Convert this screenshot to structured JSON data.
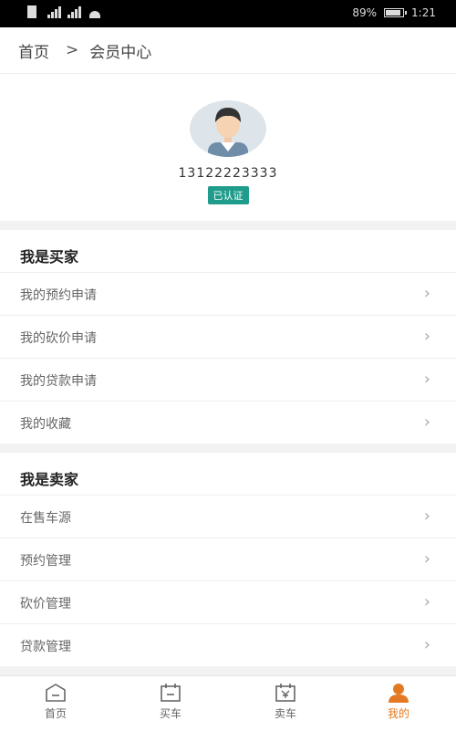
{
  "status": {
    "battery": "89%",
    "time": "1:21"
  },
  "nav": {
    "home": "首页",
    "separator": ">",
    "title": "会员中心"
  },
  "profile": {
    "phone": "13122223333",
    "badge": "已认证"
  },
  "buyer": {
    "title": "我是买家",
    "items": [
      {
        "label": "我的预约申请"
      },
      {
        "label": "我的砍价申请"
      },
      {
        "label": "我的贷款申请"
      },
      {
        "label": "我的收藏"
      }
    ]
  },
  "seller": {
    "title": "我是卖家",
    "items": [
      {
        "label": "在售车源"
      },
      {
        "label": "预约管理"
      },
      {
        "label": "砍价管理"
      },
      {
        "label": "贷款管理"
      }
    ]
  },
  "tabs": [
    {
      "label": "首页",
      "icon": "home-icon"
    },
    {
      "label": "买车",
      "icon": "buy-car-icon"
    },
    {
      "label": "卖车",
      "icon": "sell-car-icon"
    },
    {
      "label": "我的",
      "icon": "user-icon",
      "active": true
    }
  ],
  "colors": {
    "accent": "#e37a23",
    "badge": "#1f9c8b"
  }
}
